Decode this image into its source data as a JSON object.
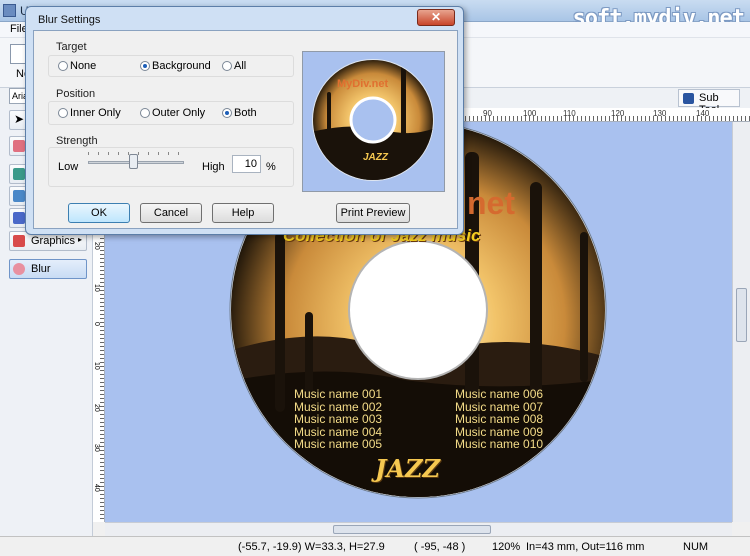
{
  "app": {
    "title": "Un",
    "watermark": "soft.mydiv.net",
    "menu_file": "File",
    "toolbar_new": "New",
    "font_box": "Arial",
    "subtool_label": "Sub Tool"
  },
  "left_panel": {
    "graphics_label": "Graphics",
    "blur_label": "Blur"
  },
  "dialog": {
    "title": "Blur Settings",
    "close_glyph": "✕",
    "target": {
      "label": "Target",
      "options": [
        "None",
        "Background",
        "All"
      ],
      "selected": "Background"
    },
    "position": {
      "label": "Position",
      "options": [
        "Inner Only",
        "Outer Only",
        "Both"
      ],
      "selected": "Both"
    },
    "strength": {
      "label": "Strength",
      "low": "Low",
      "high": "High",
      "value": "10",
      "unit": "%",
      "level_percent": 10
    },
    "buttons": {
      "ok": "OK",
      "cancel": "Cancel",
      "help": "Help",
      "print_preview": "Print Preview"
    }
  },
  "disc": {
    "title_partial": "net",
    "preview_title": "MyDiv.net",
    "subtitle": "Collection of Jazz music",
    "logo": "JAZZ",
    "tracks_left": [
      "Music name 001",
      "Music name 002",
      "Music name 003",
      "Music name 004",
      "Music name 005"
    ],
    "tracks_right": [
      "Music name 006",
      "Music name 007",
      "Music name 008",
      "Music name 009",
      "Music name 010"
    ]
  },
  "ruler_h_labels": [
    "90",
    "100",
    "110",
    "120",
    "130",
    "140"
  ],
  "ruler_v_labels": [
    "20",
    "10",
    "0",
    "10",
    "20",
    "30",
    "40",
    "50",
    "60"
  ],
  "status": {
    "coords": "(-55.7, -19.9) W=33.3, H=27.9",
    "cursor": "( -95, -48 )",
    "zoom": "120%",
    "disc_size": "In=43 mm, Out=116 mm",
    "num": "NUM"
  },
  "colors": {
    "canvas": "#a9c1ef",
    "disc_gold": "#e0a040",
    "text_yellow": "#f5d020"
  }
}
